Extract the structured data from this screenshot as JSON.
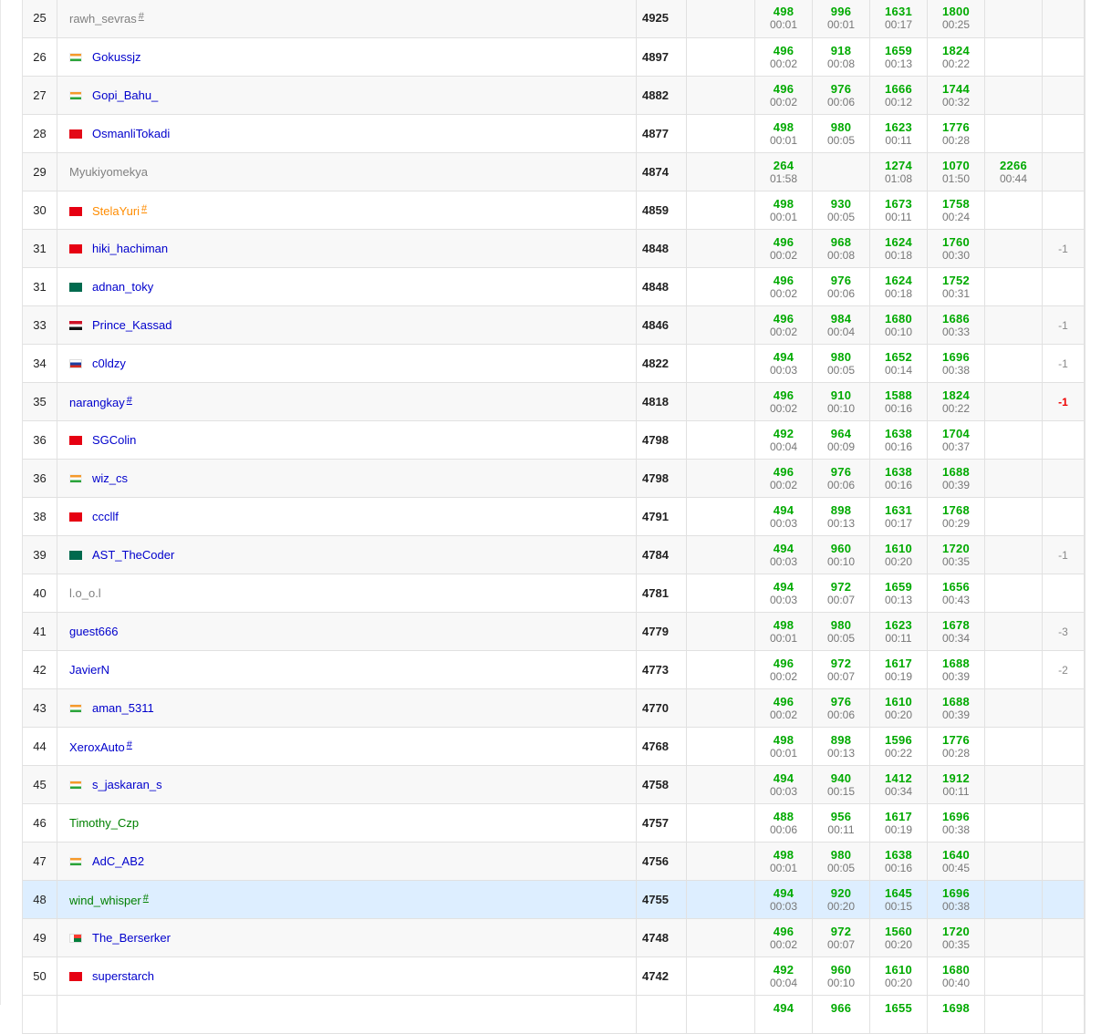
{
  "rows": [
    {
      "rank": "25",
      "name": "rawh_sevras",
      "rating": "gray",
      "flag": "none",
      "hash": "#",
      "points": "4925",
      "hacks": "",
      "p": [
        {
          "s": "498",
          "t": "00:01"
        },
        {
          "s": "996",
          "t": "00:01"
        },
        {
          "s": "1631",
          "t": "00:17"
        },
        {
          "s": "1800",
          "t": "00:25"
        },
        {
          "s": "",
          "t": ""
        }
      ],
      "rej": ""
    },
    {
      "rank": "26",
      "name": "Gokussjz",
      "rating": "blue",
      "flag": "in",
      "hash": "",
      "points": "4897",
      "hacks": "",
      "p": [
        {
          "s": "496",
          "t": "00:02"
        },
        {
          "s": "918",
          "t": "00:08"
        },
        {
          "s": "1659",
          "t": "00:13"
        },
        {
          "s": "1824",
          "t": "00:22"
        },
        {
          "s": "",
          "t": ""
        }
      ],
      "rej": ""
    },
    {
      "rank": "27",
      "name": "Gopi_Bahu_",
      "rating": "blue",
      "flag": "in",
      "hash": "",
      "points": "4882",
      "hacks": "",
      "p": [
        {
          "s": "496",
          "t": "00:02"
        },
        {
          "s": "976",
          "t": "00:06"
        },
        {
          "s": "1666",
          "t": "00:12"
        },
        {
          "s": "1744",
          "t": "00:32"
        },
        {
          "s": "",
          "t": ""
        }
      ],
      "rej": ""
    },
    {
      "rank": "28",
      "name": "OsmanliTokadi",
      "rating": "blue",
      "flag": "tr",
      "hash": "",
      "points": "4877",
      "hacks": "",
      "p": [
        {
          "s": "498",
          "t": "00:01"
        },
        {
          "s": "980",
          "t": "00:05"
        },
        {
          "s": "1623",
          "t": "00:11"
        },
        {
          "s": "1776",
          "t": "00:28"
        },
        {
          "s": "",
          "t": ""
        }
      ],
      "rej": ""
    },
    {
      "rank": "29",
      "name": "Myukiyomekya",
      "rating": "gray",
      "flag": "none",
      "hash": "",
      "points": "4874",
      "hacks": "",
      "p": [
        {
          "s": "264",
          "t": "01:58"
        },
        {
          "s": "",
          "t": ""
        },
        {
          "s": "1274",
          "t": "01:08"
        },
        {
          "s": "1070",
          "t": "01:50"
        },
        {
          "s": "2266",
          "t": "00:44"
        }
      ],
      "rej": ""
    },
    {
      "rank": "30",
      "name": "StelaYuri",
      "rating": "orange",
      "flag": "cn",
      "hash": "#",
      "points": "4859",
      "hacks": "",
      "p": [
        {
          "s": "498",
          "t": "00:01"
        },
        {
          "s": "930",
          "t": "00:05"
        },
        {
          "s": "1673",
          "t": "00:11"
        },
        {
          "s": "1758",
          "t": "00:24"
        },
        {
          "s": "",
          "t": ""
        }
      ],
      "rej": ""
    },
    {
      "rank": "31",
      "name": "hiki_hachiman",
      "rating": "blue",
      "flag": "cn",
      "hash": "",
      "points": "4848",
      "hacks": "",
      "p": [
        {
          "s": "496",
          "t": "00:02"
        },
        {
          "s": "968",
          "t": "00:08"
        },
        {
          "s": "1624",
          "t": "00:18"
        },
        {
          "s": "1760",
          "t": "00:30"
        },
        {
          "s": "",
          "t": ""
        }
      ],
      "rej": "-1"
    },
    {
      "rank": "31",
      "name": "adnan_toky",
      "rating": "blue",
      "flag": "bd",
      "hash": "",
      "points": "4848",
      "hacks": "",
      "p": [
        {
          "s": "496",
          "t": "00:02"
        },
        {
          "s": "976",
          "t": "00:06"
        },
        {
          "s": "1624",
          "t": "00:18"
        },
        {
          "s": "1752",
          "t": "00:31"
        },
        {
          "s": "",
          "t": ""
        }
      ],
      "rej": ""
    },
    {
      "rank": "33",
      "name": "Prince_Kassad",
      "rating": "blue",
      "flag": "eg",
      "hash": "",
      "points": "4846",
      "hacks": "",
      "p": [
        {
          "s": "496",
          "t": "00:02"
        },
        {
          "s": "984",
          "t": "00:04"
        },
        {
          "s": "1680",
          "t": "00:10"
        },
        {
          "s": "1686",
          "t": "00:33"
        },
        {
          "s": "",
          "t": ""
        }
      ],
      "rej": "-1"
    },
    {
      "rank": "34",
      "name": "c0ldzy",
      "rating": "blue",
      "flag": "ru",
      "hash": "",
      "points": "4822",
      "hacks": "",
      "p": [
        {
          "s": "494",
          "t": "00:03"
        },
        {
          "s": "980",
          "t": "00:05"
        },
        {
          "s": "1652",
          "t": "00:14"
        },
        {
          "s": "1696",
          "t": "00:38"
        },
        {
          "s": "",
          "t": ""
        }
      ],
      "rej": "-1"
    },
    {
      "rank": "35",
      "name": "narangkay",
      "rating": "blue",
      "flag": "none",
      "hash": "#",
      "points": "4818",
      "hacks": "",
      "p": [
        {
          "s": "496",
          "t": "00:02"
        },
        {
          "s": "910",
          "t": "00:10"
        },
        {
          "s": "1588",
          "t": "00:16"
        },
        {
          "s": "1824",
          "t": "00:22"
        },
        {
          "s": "",
          "t": ""
        }
      ],
      "rej": "-1",
      "rejRed": true
    },
    {
      "rank": "36",
      "name": "SGColin",
      "rating": "blue",
      "flag": "cn",
      "hash": "",
      "points": "4798",
      "hacks": "",
      "p": [
        {
          "s": "492",
          "t": "00:04"
        },
        {
          "s": "964",
          "t": "00:09"
        },
        {
          "s": "1638",
          "t": "00:16"
        },
        {
          "s": "1704",
          "t": "00:37"
        },
        {
          "s": "",
          "t": ""
        }
      ],
      "rej": ""
    },
    {
      "rank": "36",
      "name": "wiz_cs",
      "rating": "blue",
      "flag": "in",
      "hash": "",
      "points": "4798",
      "hacks": "",
      "p": [
        {
          "s": "496",
          "t": "00:02"
        },
        {
          "s": "976",
          "t": "00:06"
        },
        {
          "s": "1638",
          "t": "00:16"
        },
        {
          "s": "1688",
          "t": "00:39"
        },
        {
          "s": "",
          "t": ""
        }
      ],
      "rej": ""
    },
    {
      "rank": "38",
      "name": "cccllf",
      "rating": "blue",
      "flag": "cn",
      "hash": "",
      "points": "4791",
      "hacks": "",
      "p": [
        {
          "s": "494",
          "t": "00:03"
        },
        {
          "s": "898",
          "t": "00:13"
        },
        {
          "s": "1631",
          "t": "00:17"
        },
        {
          "s": "1768",
          "t": "00:29"
        },
        {
          "s": "",
          "t": ""
        }
      ],
      "rej": ""
    },
    {
      "rank": "39",
      "name": "AST_TheCoder",
      "rating": "blue",
      "flag": "bd",
      "hash": "",
      "points": "4784",
      "hacks": "",
      "p": [
        {
          "s": "494",
          "t": "00:03"
        },
        {
          "s": "960",
          "t": "00:10"
        },
        {
          "s": "1610",
          "t": "00:20"
        },
        {
          "s": "1720",
          "t": "00:35"
        },
        {
          "s": "",
          "t": ""
        }
      ],
      "rej": "-1"
    },
    {
      "rank": "40",
      "name": "l.o_o.l",
      "rating": "gray",
      "flag": "none",
      "hash": "",
      "points": "4781",
      "hacks": "",
      "p": [
        {
          "s": "494",
          "t": "00:03"
        },
        {
          "s": "972",
          "t": "00:07"
        },
        {
          "s": "1659",
          "t": "00:13"
        },
        {
          "s": "1656",
          "t": "00:43"
        },
        {
          "s": "",
          "t": ""
        }
      ],
      "rej": ""
    },
    {
      "rank": "41",
      "name": "guest666",
      "rating": "blue",
      "flag": "none",
      "hash": "",
      "points": "4779",
      "hacks": "",
      "p": [
        {
          "s": "498",
          "t": "00:01"
        },
        {
          "s": "980",
          "t": "00:05"
        },
        {
          "s": "1623",
          "t": "00:11"
        },
        {
          "s": "1678",
          "t": "00:34"
        },
        {
          "s": "",
          "t": ""
        }
      ],
      "rej": "-3"
    },
    {
      "rank": "42",
      "name": "JavierN",
      "rating": "blue",
      "flag": "none",
      "hash": "",
      "points": "4773",
      "hacks": "",
      "p": [
        {
          "s": "496",
          "t": "00:02"
        },
        {
          "s": "972",
          "t": "00:07"
        },
        {
          "s": "1617",
          "t": "00:19"
        },
        {
          "s": "1688",
          "t": "00:39"
        },
        {
          "s": "",
          "t": ""
        }
      ],
      "rej": "-2"
    },
    {
      "rank": "43",
      "name": "aman_5311",
      "rating": "blue",
      "flag": "in",
      "hash": "",
      "points": "4770",
      "hacks": "",
      "p": [
        {
          "s": "496",
          "t": "00:02"
        },
        {
          "s": "976",
          "t": "00:06"
        },
        {
          "s": "1610",
          "t": "00:20"
        },
        {
          "s": "1688",
          "t": "00:39"
        },
        {
          "s": "",
          "t": ""
        }
      ],
      "rej": ""
    },
    {
      "rank": "44",
      "name": "XeroxAuto",
      "rating": "blue",
      "flag": "none",
      "hash": "#",
      "points": "4768",
      "hacks": "",
      "p": [
        {
          "s": "498",
          "t": "00:01"
        },
        {
          "s": "898",
          "t": "00:13"
        },
        {
          "s": "1596",
          "t": "00:22"
        },
        {
          "s": "1776",
          "t": "00:28"
        },
        {
          "s": "",
          "t": ""
        }
      ],
      "rej": ""
    },
    {
      "rank": "45",
      "name": "s_jaskaran_s",
      "rating": "blue",
      "flag": "in",
      "hash": "",
      "points": "4758",
      "hacks": "",
      "p": [
        {
          "s": "494",
          "t": "00:03"
        },
        {
          "s": "940",
          "t": "00:15"
        },
        {
          "s": "1412",
          "t": "00:34"
        },
        {
          "s": "1912",
          "t": "00:11"
        },
        {
          "s": "",
          "t": ""
        }
      ],
      "rej": ""
    },
    {
      "rank": "46",
      "name": "Timothy_Czp",
      "rating": "green",
      "flag": "none",
      "hash": "",
      "points": "4757",
      "hacks": "",
      "p": [
        {
          "s": "488",
          "t": "00:06"
        },
        {
          "s": "956",
          "t": "00:11"
        },
        {
          "s": "1617",
          "t": "00:19"
        },
        {
          "s": "1696",
          "t": "00:38"
        },
        {
          "s": "",
          "t": ""
        }
      ],
      "rej": ""
    },
    {
      "rank": "47",
      "name": "AdC_AB2",
      "rating": "blue",
      "flag": "in",
      "hash": "",
      "points": "4756",
      "hacks": "",
      "p": [
        {
          "s": "498",
          "t": "00:01"
        },
        {
          "s": "980",
          "t": "00:05"
        },
        {
          "s": "1638",
          "t": "00:16"
        },
        {
          "s": "1640",
          "t": "00:45"
        },
        {
          "s": "",
          "t": ""
        }
      ],
      "rej": ""
    },
    {
      "rank": "48",
      "name": "wind_whisper",
      "rating": "green",
      "flag": "none",
      "hash": "#",
      "points": "4755",
      "hacks": "",
      "p": [
        {
          "s": "494",
          "t": "00:03"
        },
        {
          "s": "920",
          "t": "00:20"
        },
        {
          "s": "1645",
          "t": "00:15"
        },
        {
          "s": "1696",
          "t": "00:38"
        },
        {
          "s": "",
          "t": ""
        }
      ],
      "rej": "",
      "highlight": true
    },
    {
      "rank": "49",
      "name": "The_Berserker",
      "rating": "blue",
      "flag": "mg",
      "hash": "",
      "points": "4748",
      "hacks": "",
      "p": [
        {
          "s": "496",
          "t": "00:02"
        },
        {
          "s": "972",
          "t": "00:07"
        },
        {
          "s": "1560",
          "t": "00:20"
        },
        {
          "s": "1720",
          "t": "00:35"
        },
        {
          "s": "",
          "t": ""
        }
      ],
      "rej": ""
    },
    {
      "rank": "50",
      "name": "superstarch",
      "rating": "blue",
      "flag": "cn",
      "hash": "",
      "points": "4742",
      "hacks": "",
      "p": [
        {
          "s": "492",
          "t": "00:04"
        },
        {
          "s": "960",
          "t": "00:10"
        },
        {
          "s": "1610",
          "t": "00:20"
        },
        {
          "s": "1680",
          "t": "00:40"
        },
        {
          "s": "",
          "t": ""
        }
      ],
      "rej": ""
    }
  ],
  "partial_row": {
    "p": [
      {
        "s": "494"
      },
      {
        "s": "966"
      },
      {
        "s": "1655"
      },
      {
        "s": "1698"
      }
    ]
  },
  "colors": {
    "gray": "#808080",
    "blue": "#0000cc",
    "orange": "#ff8c00",
    "green": "#008000",
    "accepted": "#00aa00",
    "highlight": "#ddeeff"
  }
}
